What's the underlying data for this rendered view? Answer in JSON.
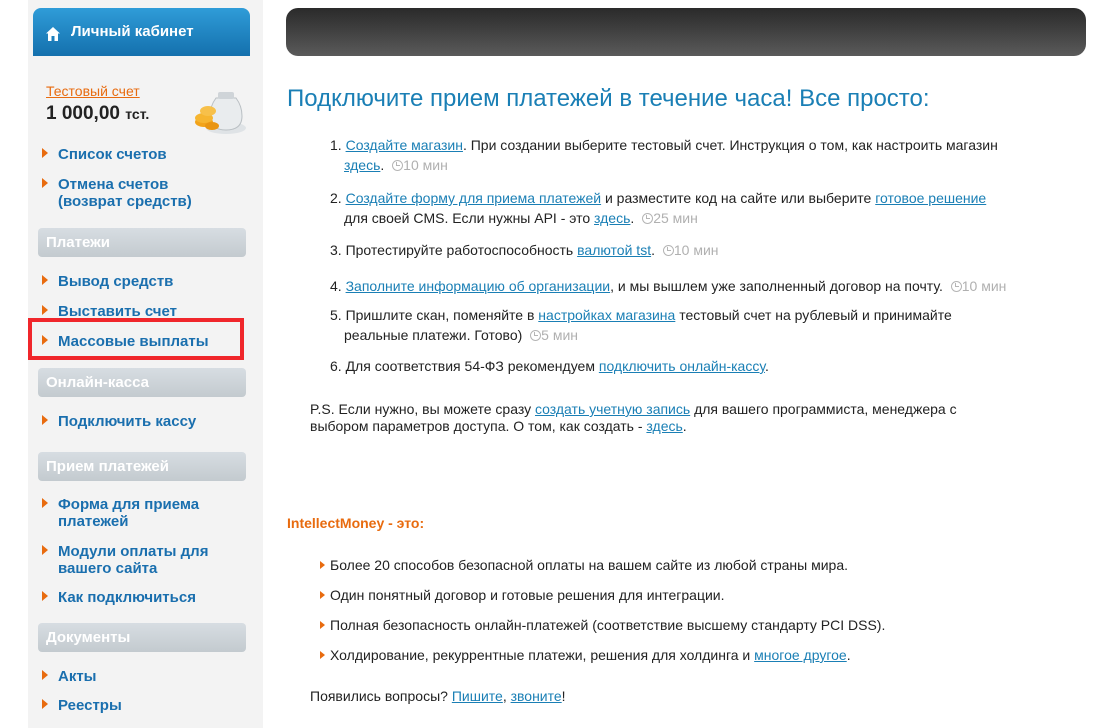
{
  "sidebar": {
    "header_title": "Личный кабинет",
    "test_account_label": "Тестовый счет",
    "balance_amount": "1 000,00",
    "balance_currency": "тст.",
    "items": {
      "accounts_list": "Список счетов",
      "cancel_line1": "Отмена счетов",
      "cancel_line2": "(возврат средств)",
      "withdraw": "Вывод средств",
      "invoice": "Выставить счет",
      "mass_payouts": "Массовые выплаты",
      "connect_kassa": "Подключить кассу",
      "form_line1": "Форма для приема",
      "form_line2": "платежей",
      "modules_line1": "Модули оплаты для",
      "modules_line2": "вашего сайта",
      "how_connect": "Как подключиться",
      "acts": "Акты",
      "registers": "Реестры"
    },
    "sections": {
      "payments": "Платежи",
      "online_kassa": "Онлайн-касса",
      "accepting": "Прием платежей",
      "documents": "Документы"
    }
  },
  "main": {
    "title": "Подключите прием платежей в течение часа! Все просто:",
    "steps": {
      "s1_num": "1.",
      "s1_link": "Создайте магазин",
      "s1_text": ". При создании выберите тестовый счет. Инструкция о том, как настроить магазин",
      "s1_link2": "здесь",
      "s1_time": "10 мин",
      "s2_num": "2.",
      "s2_link": "Создайте форму для приема платежей",
      "s2_text": " и разместите код на сайте или выберите ",
      "s2_link2": "готовое решение",
      "s2_text2": "для своей CMS. Если нужны API - это ",
      "s2_link3": "здесь",
      "s2_time": "25 мин",
      "s3_num": "3.",
      "s3_text": "Протестируйте работоспособность ",
      "s3_link": "валютой tst",
      "s3_time": "10 мин",
      "s4_num": "4.",
      "s4_link": "Заполните информацию об организации",
      "s4_text": ", и мы вышлем уже заполненный договор на почту.",
      "s4_time": "10 мин",
      "s5_num": "5.",
      "s5_text": "Пришлите скан, поменяйте в ",
      "s5_link": "настройках магазина",
      "s5_text2": " тестовый счет на рублевый и принимайте",
      "s5_text3": "реальные платежи. Готово)",
      "s5_time": "5 мин",
      "s6_num": "6.",
      "s6_text": "Для соответствия 54-ФЗ рекомендуем ",
      "s6_link": "подключить онлайн-кассу",
      "s6_end": "."
    },
    "ps": {
      "text1": "P.S. Если нужно, вы можете сразу ",
      "link1": "создать учетную запись",
      "text2": " для вашего программиста, менеджера с",
      "text3": "выбором параметров доступа. О том, как создать - ",
      "link2": "здесь",
      "end": "."
    },
    "im_title": "IntellectMoney - это:",
    "features": {
      "f1": "Более 20 способов безопасной оплаты на вашем сайте из любой страны мира.",
      "f2": "Один понятный договор и готовые решения для интеграции.",
      "f3": "Полная безопасность онлайн-платежей (соответствие высшему стандарту PCI DSS).",
      "f4": "Холдирование, рекуррентные платежи, решения для холдинга и ",
      "f4_link": "многое другое",
      "f4_end": "."
    },
    "questions": {
      "text": "Появились вопросы? ",
      "link1": "Пишите",
      "comma": ", ",
      "link2": "звоните",
      "end": "!"
    }
  },
  "icons": {
    "home": "home-icon",
    "coins": "coins-bag-icon",
    "clock": "clock-icon",
    "arrow": "arrow-right-icon"
  },
  "colors": {
    "accent_orange": "#e86b0f",
    "link_blue": "#1a7fb5",
    "highlight_red": "#f0262b",
    "header_blue": "#1470ad"
  }
}
